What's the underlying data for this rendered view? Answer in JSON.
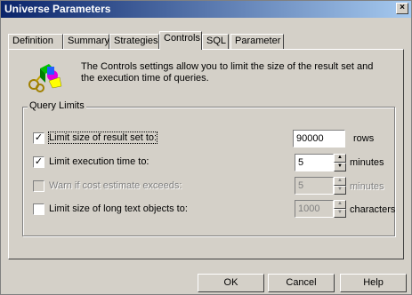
{
  "window": {
    "title": "Universe Parameters",
    "close_glyph": "×"
  },
  "tabs": [
    "Definition",
    "Summary",
    "Strategies",
    "Controls",
    "SQL",
    "Parameter"
  ],
  "active_tab": "Controls",
  "description": "The Controls settings allow you to limit the size of the result set and the execution time of queries.",
  "group": {
    "title": "Query Limits"
  },
  "limits": [
    {
      "label": "Limit size of result set to:",
      "checked": true,
      "enabled": true,
      "value": "90000",
      "unit": "rows",
      "spinner": false
    },
    {
      "label": "Limit execution time to:",
      "checked": true,
      "enabled": true,
      "value": "5",
      "unit": "minutes",
      "spinner": true
    },
    {
      "label": "Warn if cost estimate exceeds:",
      "checked": false,
      "enabled": false,
      "value": "5",
      "unit": "minutes",
      "spinner": true
    },
    {
      "label": "Limit size of long text objects to:",
      "checked": false,
      "enabled": true,
      "value": "1000",
      "unit": "characters",
      "spinner": true
    }
  ],
  "buttons": {
    "ok": "OK",
    "cancel": "Cancel",
    "help": "Help"
  },
  "check_glyph": "✓"
}
